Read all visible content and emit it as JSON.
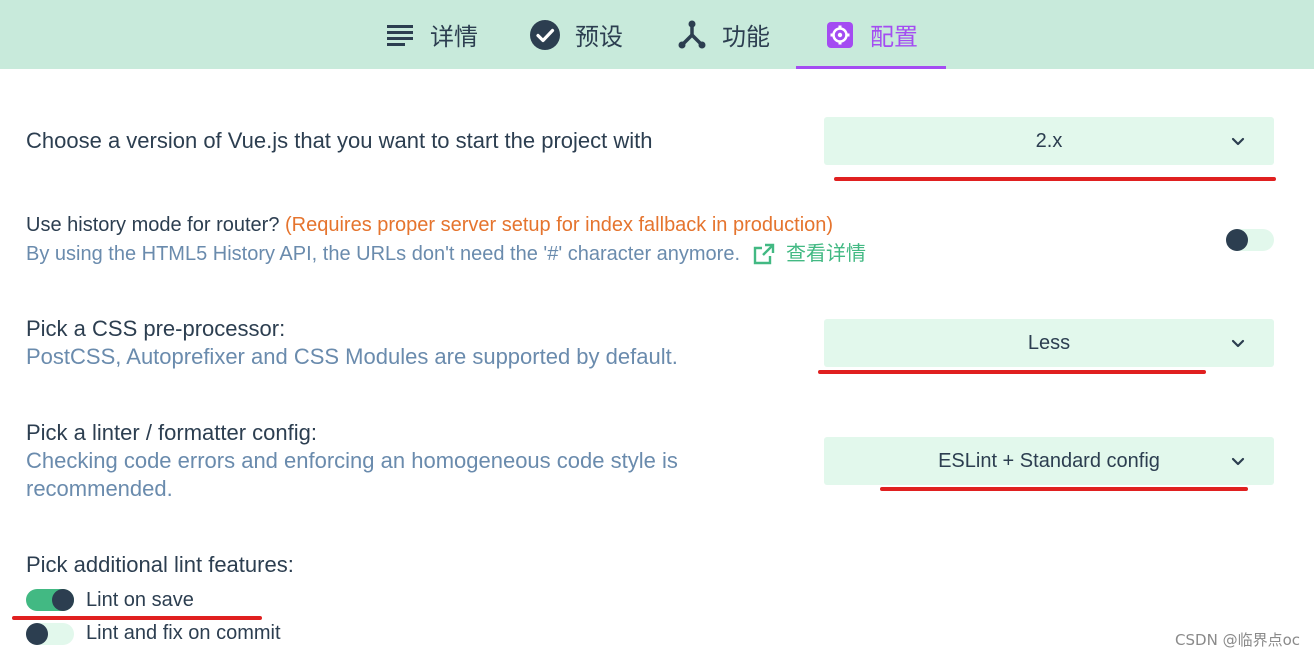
{
  "tabs": [
    {
      "label": "详情",
      "icon": "list-icon"
    },
    {
      "label": "预设",
      "icon": "check-circle-icon"
    },
    {
      "label": "功能",
      "icon": "fork-icon"
    },
    {
      "label": "配置",
      "icon": "gear-icon",
      "active": true
    }
  ],
  "vue_version": {
    "label": "Choose a version of Vue.js that you want to start the project with",
    "selected": "2.x"
  },
  "history_mode": {
    "label": "Use history mode for router?",
    "warning": "(Requires proper server setup for index fallback in production)",
    "description": "By using the HTML5 History API, the URLs don't need the '#' character anymore.",
    "link_text": "查看详情",
    "enabled": false
  },
  "css_preprocessor": {
    "label": "Pick a CSS pre-processor:",
    "description": "PostCSS, Autoprefixer and CSS Modules are supported by default.",
    "selected": "Less"
  },
  "linter": {
    "label": "Pick a linter / formatter config:",
    "description_line1": "Checking code errors and enforcing an homogeneous code style is",
    "description_line2": "recommended.",
    "selected": "ESLint + Standard config"
  },
  "lint_features": {
    "label": "Pick additional lint features:",
    "options": [
      {
        "label": "Lint on save",
        "enabled": true
      },
      {
        "label": "Lint and fix on commit",
        "enabled": false
      }
    ]
  },
  "watermark": "CSDN @临界点oc",
  "colors": {
    "accent_green": "#42b983",
    "active_tab": "#a44cf2",
    "tabbar_bg": "#c8eadb",
    "select_bg": "#e2f8ec",
    "warning": "#e5742e",
    "annotation_red": "#e02020"
  }
}
